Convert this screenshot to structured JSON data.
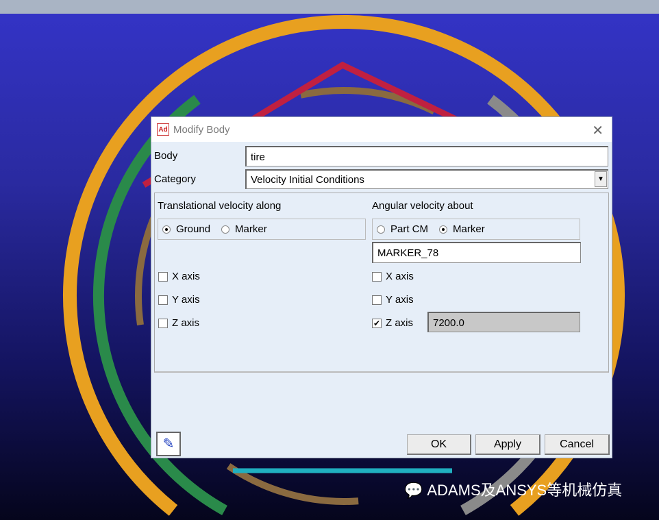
{
  "dialog": {
    "title": "Modify Body",
    "app_icon": "Ad",
    "body_label": "Body",
    "body_value": "tire",
    "category_label": "Category",
    "category_value": "Velocity Initial Conditions",
    "translational": {
      "heading": "Translational velocity along",
      "ref_options": [
        "Ground",
        "Marker"
      ],
      "ref_selected": "Ground",
      "axes": [
        {
          "label": "X axis",
          "checked": false
        },
        {
          "label": "Y axis",
          "checked": false
        },
        {
          "label": "Z axis",
          "checked": false
        }
      ]
    },
    "angular": {
      "heading": "Angular velocity about",
      "ref_options": [
        "Part CM",
        "Marker"
      ],
      "ref_selected": "Marker",
      "marker_value": "MARKER_78",
      "axes": [
        {
          "label": "X axis",
          "checked": false
        },
        {
          "label": "Y axis",
          "checked": false
        },
        {
          "label": "Z axis",
          "checked": true,
          "value": "7200.0"
        }
      ]
    },
    "buttons": {
      "ok": "OK",
      "apply": "Apply",
      "cancel": "Cancel"
    }
  },
  "watermark": "ADAMS及ANSYS等机械仿真",
  "colors": {
    "ring": "#e8a020",
    "dialog_bg": "#e6eef8"
  }
}
